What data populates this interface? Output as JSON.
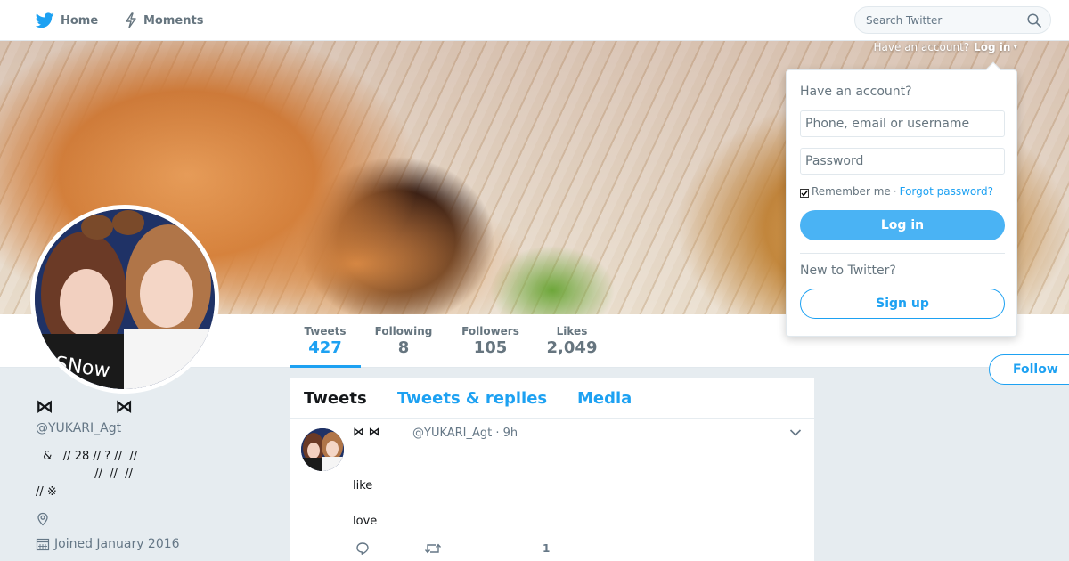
{
  "nav": {
    "home_label": "Home",
    "moments_label": "Moments",
    "search_placeholder": "Search Twitter"
  },
  "login_hint": {
    "prefix": "Have an account?",
    "action": "Log in"
  },
  "login_box": {
    "heading": "Have an account?",
    "username_placeholder": "Phone, email or username",
    "password_placeholder": "Password",
    "remember_label": "Remember me",
    "separator": "·",
    "forgot_label": "Forgot password?",
    "login_label": "Log in",
    "new_heading": "New to Twitter?",
    "signup_label": "Sign up"
  },
  "stats": [
    {
      "label": "Tweets",
      "value": "427"
    },
    {
      "label": "Following",
      "value": "8"
    },
    {
      "label": "Followers",
      "value": "105"
    },
    {
      "label": "Likes",
      "value": "2,049"
    }
  ],
  "follow_label": "Follow",
  "profile": {
    "name": "⋈ ᅠᅠᅠ ⋈",
    "handle": "@YUKARI_Agt",
    "bio_lines": [
      "  &   // 28 // ? //  //",
      "                //  //  //",
      "// ※"
    ],
    "joined": "Joined January 2016"
  },
  "timeline": {
    "tabs": [
      "Tweets",
      "Tweets & replies",
      "Media"
    ]
  },
  "tweet": {
    "name": "⋈  ⋈",
    "meta": "@YUKARI_Agt · 9h",
    "line1": "like",
    "line2": "love",
    "like_count": "1"
  },
  "colors": {
    "accent": "#1da1f2",
    "login_button": "#4ab3f4",
    "page_bg": "#e6ecf0"
  },
  "icons": [
    "twitter-bird-icon",
    "lightning-icon",
    "search-icon",
    "checkbox-icon",
    "caret-down-icon",
    "location-pin-icon",
    "calendar-icon",
    "reply-icon",
    "retweet-icon",
    "heart-icon"
  ]
}
